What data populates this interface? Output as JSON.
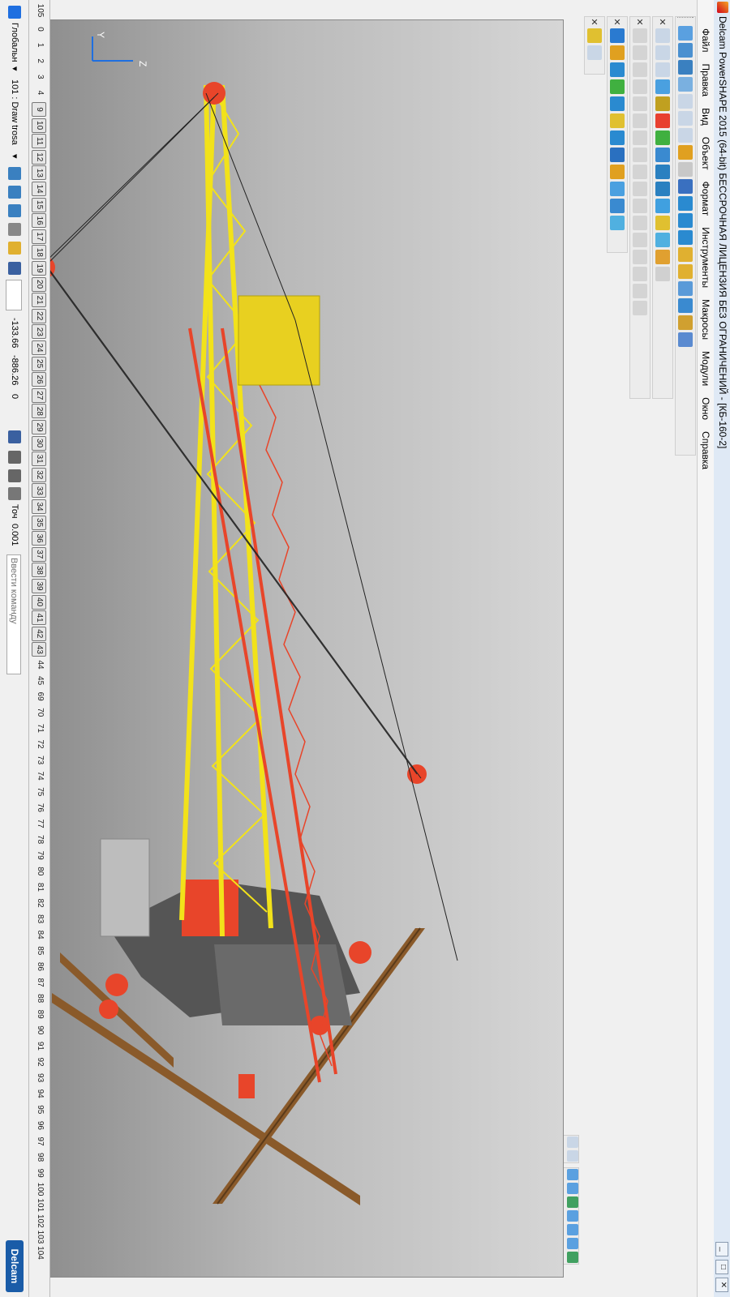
{
  "window": {
    "title": "Delcam PowerSHAPE 2015 (64-bit) БЕССРОЧНАЯ ЛИЦЕНЗИЯ БЕЗ ОГРАНИЧЕНИЙ - [КБ-160-2]",
    "minimize": "_",
    "restore": "□",
    "close": "✕"
  },
  "menu": [
    "Файл",
    "Правка",
    "Вид",
    "Объект",
    "Формат",
    "Инструменты",
    "Макросы",
    "Модули",
    "Окно",
    "Справка"
  ],
  "statusbar": {
    "workplane": "Глобальн",
    "dropdown_arrow": "▾",
    "level": "101 : Draw trosa",
    "coord_x": "-133.66",
    "coord_y": "-886.26",
    "coord_z": "0",
    "snap_label": "Точ",
    "snap_value": "0.001",
    "command_placeholder": "Ввести команду",
    "brand": "Delcam"
  },
  "levels": {
    "corner": "105",
    "plain_start": [
      "0",
      "1",
      "2",
      "3",
      "4"
    ],
    "boxed": [
      "9",
      "10",
      "11",
      "12",
      "13",
      "14",
      "15",
      "16",
      "17",
      "18",
      "19",
      "20",
      "21",
      "22",
      "23",
      "24",
      "25",
      "26",
      "27",
      "28",
      "29",
      "30",
      "31",
      "32",
      "33",
      "34",
      "35",
      "36",
      "37",
      "38",
      "39",
      "40",
      "41",
      "42",
      "43"
    ],
    "plain_end": [
      "44",
      "45",
      "69",
      "70",
      "71",
      "72",
      "73",
      "74",
      "75",
      "76",
      "77",
      "78",
      "79",
      "80",
      "81",
      "82",
      "83",
      "84",
      "85",
      "86",
      "87",
      "88",
      "89",
      "90",
      "91",
      "92",
      "93",
      "94",
      "95",
      "96",
      "97",
      "98",
      "99",
      "100",
      "101",
      "102",
      "103",
      "104"
    ]
  },
  "triad": {
    "z": "Z",
    "y": "Y"
  },
  "colors": {
    "boom": "#f2e21a",
    "jib": "#e8452a",
    "base": "#555555",
    "cab": "#e8d020",
    "rail": "#8a5a2a",
    "counterweight": "#bdbdbd"
  }
}
